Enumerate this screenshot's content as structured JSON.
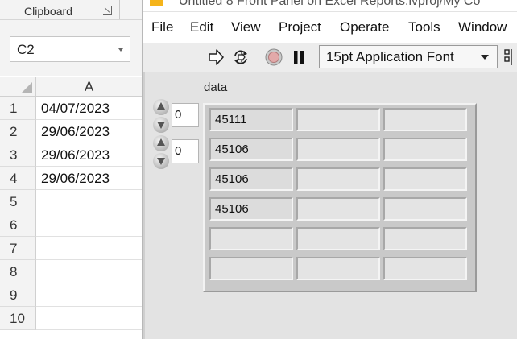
{
  "excel": {
    "ribbon_group_label": "Clipboard",
    "name_box_value": "C2",
    "column_header": "A",
    "rows": [
      {
        "num": "1",
        "a": "04/07/2023"
      },
      {
        "num": "2",
        "a": "29/06/2023"
      },
      {
        "num": "3",
        "a": "29/06/2023"
      },
      {
        "num": "4",
        "a": "29/06/2023"
      },
      {
        "num": "5",
        "a": ""
      },
      {
        "num": "6",
        "a": ""
      },
      {
        "num": "7",
        "a": ""
      },
      {
        "num": "8",
        "a": ""
      },
      {
        "num": "9",
        "a": ""
      },
      {
        "num": "10",
        "a": ""
      }
    ]
  },
  "labview": {
    "window_title": "Untitled 8 Front Panel on Excel Reports.lvproj/My Co",
    "menu": [
      "File",
      "Edit",
      "View",
      "Project",
      "Operate",
      "Tools",
      "Window"
    ],
    "toolbar": {
      "icons": [
        "run-arrow-icon",
        "run-continuously-icon",
        "abort-icon",
        "pause-icon",
        "align-objects-icon"
      ],
      "font_select": "15pt Application Font"
    },
    "array": {
      "label": "data",
      "index_row": "0",
      "index_col": "0",
      "rows": [
        [
          "45111",
          "",
          ""
        ],
        [
          "45106",
          "",
          ""
        ],
        [
          "45106",
          "",
          ""
        ],
        [
          "45106",
          "",
          ""
        ],
        [
          "",
          "",
          ""
        ],
        [
          "",
          "",
          ""
        ]
      ]
    },
    "colors": {
      "panel_bg": "#e3e3e3",
      "logo": "#f5b41a"
    }
  }
}
